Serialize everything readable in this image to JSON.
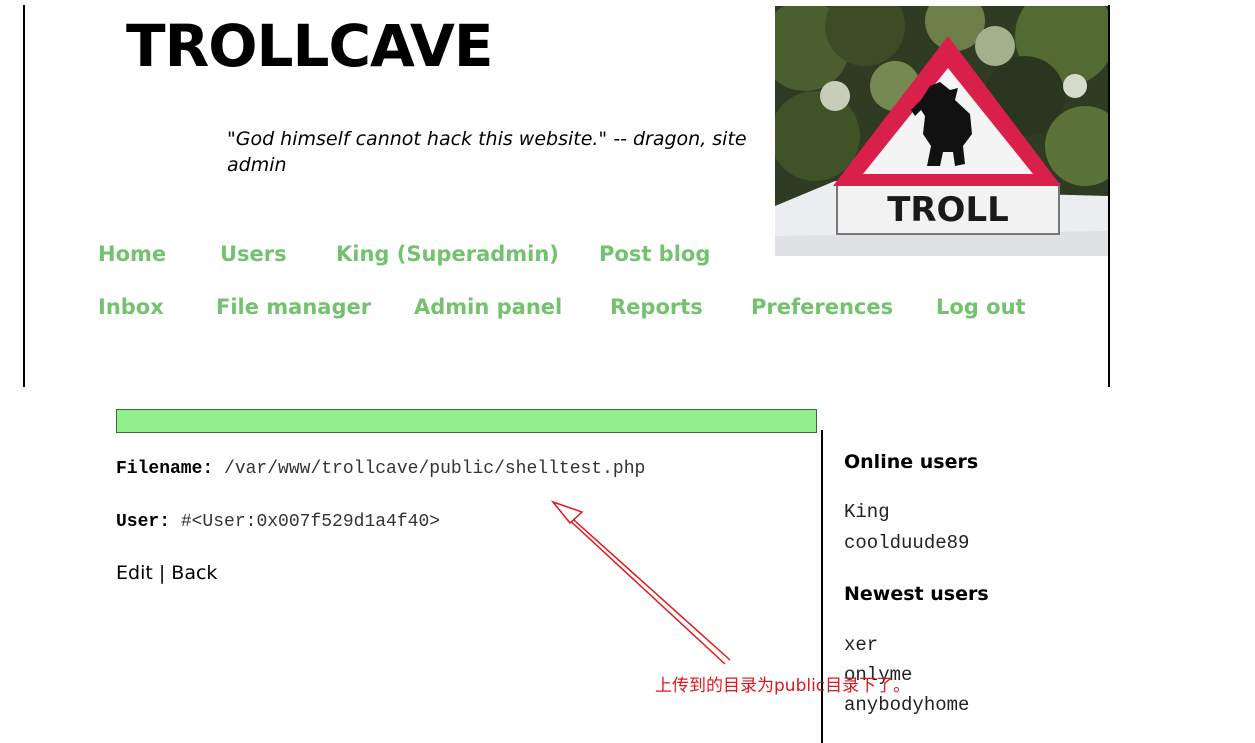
{
  "header": {
    "site_title": "TROLLCAVE",
    "tagline": "\"God himself cannot hack this website.\" -- dragon, site admin",
    "sign_text": "TROLL"
  },
  "nav": {
    "row1": [
      "Home",
      "Users",
      "King (Superadmin)",
      "Post blog"
    ],
    "row2": [
      "Inbox",
      "File manager",
      "Admin panel",
      "Reports",
      "Preferences",
      "Log out"
    ],
    "color": "#74c26f"
  },
  "flash": {
    "color": "#90ee8c"
  },
  "file": {
    "filename_label": "Filename:",
    "filename_value": "/var/www/trollcave/public/shelltest.php",
    "user_label": "User:",
    "user_value": "#<User:0x007f529d1a4f40>"
  },
  "actions": {
    "edit": "Edit",
    "separator": "|",
    "back": "Back"
  },
  "sidebar": {
    "online_title": "Online users",
    "online": [
      "King",
      "coolduude89"
    ],
    "newest_title": "Newest users",
    "newest": [
      "xer",
      "onlyme",
      "anybodyhome"
    ]
  },
  "annotation": {
    "text": "上传到的目录为public目录下了。",
    "color": "#e0181c"
  }
}
